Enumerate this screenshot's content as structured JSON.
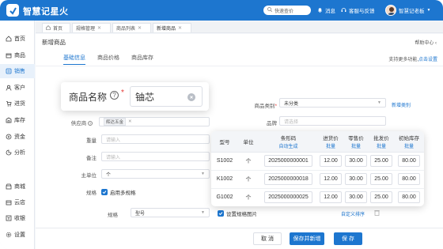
{
  "app": {
    "title": "智慧记星火"
  },
  "topbar": {
    "search_placeholder": "快速查价",
    "messages": "消息",
    "support": "客服与反馈",
    "user": "智慧记老板"
  },
  "sidebar": {
    "items": [
      {
        "label": "首页",
        "icon": "home-icon"
      },
      {
        "label": "商品",
        "icon": "box-icon"
      },
      {
        "label": "销售",
        "icon": "sales-icon"
      },
      {
        "label": "客户",
        "icon": "customer-icon"
      },
      {
        "label": "进货",
        "icon": "purchase-icon"
      },
      {
        "label": "库存",
        "icon": "inventory-icon"
      },
      {
        "label": "资金",
        "icon": "money-icon"
      },
      {
        "label": "分析",
        "icon": "chart-icon"
      },
      {
        "label": "商城",
        "icon": "mall-icon"
      },
      {
        "label": "云店",
        "icon": "cloud-store-icon"
      },
      {
        "label": "收银",
        "icon": "cashier-icon"
      },
      {
        "label": "设置",
        "icon": "gear-icon"
      }
    ],
    "active_index": 2
  },
  "tabs": [
    {
      "label": "首页"
    },
    {
      "label": "规格管理"
    },
    {
      "label": "商品列表"
    },
    {
      "label": "新增商品"
    }
  ],
  "page": {
    "title": "新增商品",
    "help": "帮助中心",
    "subtabs": [
      "基础信息",
      "商品价格",
      "商品库存"
    ],
    "import_note": "支持更多功能,",
    "import_link": "点击设置"
  },
  "form": {
    "supplier_label": "供应商",
    "supplier_tag": "辉达五金",
    "weight_label": "重量",
    "weight_placeholder": "请输入",
    "remark_label": "备注",
    "remark_placeholder": "请输入",
    "unit_label": "主单位",
    "unit_value": "个",
    "spec_label": "规格",
    "enable_multi_spec": "启用多规格",
    "spec_sub_label": "规格",
    "spec_sub_value": "型号",
    "category_label": "商品类别",
    "category_value": "未分类",
    "new_category": "新增类别",
    "brand_label": "品牌",
    "brand_placeholder": "请选择",
    "set_spec_image": "设置规格图片",
    "custom_sort": "自定义排序"
  },
  "callout": {
    "label": "商品名称",
    "required_mark": "*",
    "value": "铀芯"
  },
  "spec_table": {
    "headers": [
      {
        "main": "型号",
        "sub": ""
      },
      {
        "main": "单位",
        "sub": ""
      },
      {
        "main": "条形码",
        "sub": "自动生成"
      },
      {
        "main": "进货价",
        "sub": "批量"
      },
      {
        "main": "零售价",
        "sub": "批量"
      },
      {
        "main": "批发价",
        "sub": "批量"
      },
      {
        "main": "初始库存",
        "sub": "批量"
      }
    ],
    "rows": [
      [
        "S1002",
        "个",
        "2025000000001",
        "12.00",
        "30.00",
        "25.00",
        "80.00"
      ],
      [
        "K1002",
        "个",
        "2025000000018",
        "12.00",
        "30.00",
        "25.00",
        "80.00"
      ],
      [
        "G1002",
        "个",
        "2025000000025",
        "12.00",
        "30.00",
        "25.00",
        "80.00"
      ]
    ]
  },
  "footer": {
    "cancel": "取 消",
    "save_new": "保存并新增",
    "save": "保 存"
  },
  "colors": {
    "primary": "#1d76cf",
    "required": "#e53935"
  }
}
